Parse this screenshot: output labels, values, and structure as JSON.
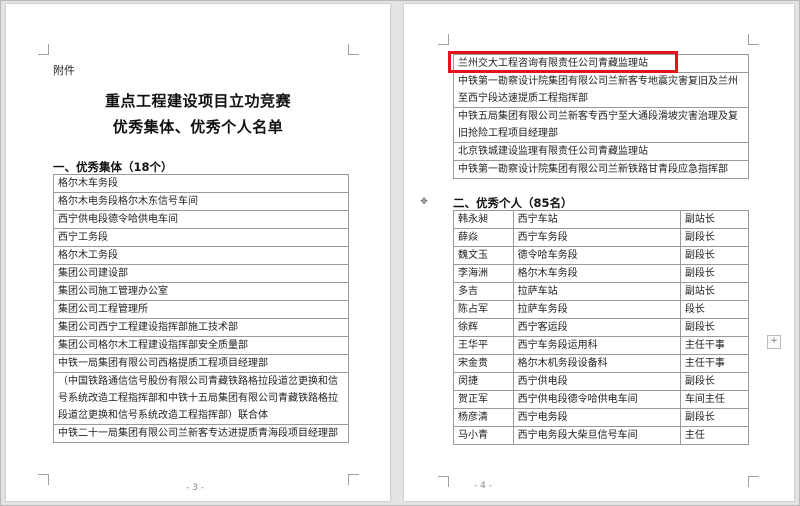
{
  "left_page": {
    "attachment_label": "附件",
    "title_line1": "重点工程建设项目立功竞赛",
    "title_line2": "优秀集体、优秀个人名单",
    "section1_heading": "一、优秀集体（18个）",
    "collectives": [
      "格尔木车务段",
      "格尔木电务段格尔木东信号车间",
      "西宁供电段德令哈供电车间",
      "西宁工务段",
      "格尔木工务段",
      "集团公司建设部",
      "集团公司施工管理办公室",
      "集团公司工程管理所",
      "集团公司西宁工程建设指挥部施工技术部",
      "集团公司格尔木工程建设指挥部安全质量部",
      "中铁一局集团有限公司西格提质工程项目经理部",
      "（中国铁路通信信号股份有限公司青藏铁路格拉段道岔更换和信号系统改造工程指挥部和中铁十五局集团有限公司青藏铁路格拉段道岔更换和信号系统改造工程指挥部）联合体",
      "中铁二十一局集团有限公司兰新客专达进提质青海段项目经理部"
    ],
    "page_number": "- 3 -"
  },
  "right_page": {
    "collectives_cont": [
      "兰州交大工程咨询有限责任公司青藏监理站",
      "中铁第一勘察设计院集团有限公司兰新客专地震灾害复旧及兰州至西宁段达速提质工程指挥部",
      "中铁五局集团有限公司兰新客专西宁至大通段滑坡灾害治理及复旧抢险工程项目经理部",
      "北京铁城建设监理有限责任公司青藏监理站",
      "中铁第一勘察设计院集团有限公司兰新铁路甘青段应急指挥部"
    ],
    "section2_heading": "二、优秀个人（85名）",
    "individuals": [
      {
        "name": "韩永昶",
        "unit": "西宁车站",
        "title": "副站长"
      },
      {
        "name": "薛焱",
        "unit": "西宁车务段",
        "title": "副段长"
      },
      {
        "name": "魏文玉",
        "unit": "德令哈车务段",
        "title": "副段长"
      },
      {
        "name": "李海洲",
        "unit": "格尔木车务段",
        "title": "副段长"
      },
      {
        "name": "多吉",
        "unit": "拉萨车站",
        "title": "副站长"
      },
      {
        "name": "陈占军",
        "unit": "拉萨车务段",
        "title": "段长"
      },
      {
        "name": "徐辉",
        "unit": "西宁客运段",
        "title": "副段长"
      },
      {
        "name": "王华平",
        "unit": "西宁车务段运用科",
        "title": "主任干事"
      },
      {
        "name": "宋金贵",
        "unit": "格尔木机务段设备科",
        "title": "主任干事"
      },
      {
        "name": "闵捷",
        "unit": "西宁供电段",
        "title": "副段长"
      },
      {
        "name": "贺正军",
        "unit": "西宁供电段德令哈供电车间",
        "title": "车间主任"
      },
      {
        "name": "杨彦清",
        "unit": "西宁电务段",
        "title": "副段长"
      },
      {
        "name": "马小青",
        "unit": "西宁电务段大柴旦信号车间",
        "title": "主任"
      }
    ],
    "page_number": "- 4 -"
  },
  "colors": {
    "highlight": "#e3131b",
    "page_bg": "#ffffff",
    "workspace_bg": "#e4e4e4"
  }
}
